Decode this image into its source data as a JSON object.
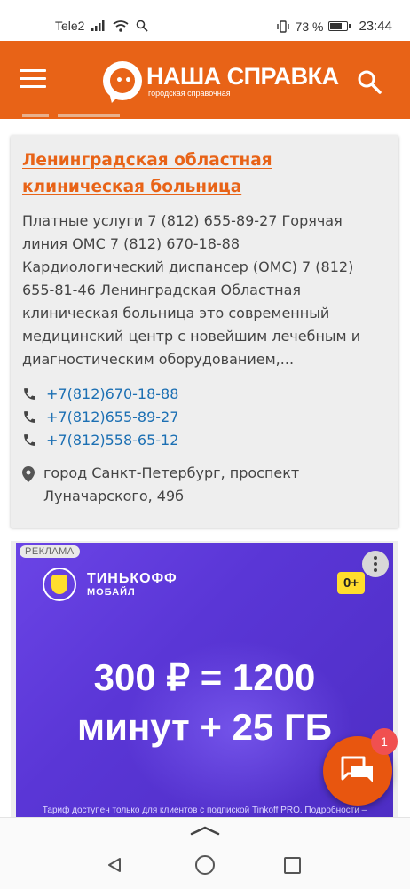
{
  "status_bar": {
    "carrier": "Tele2",
    "battery_percent": "73 %",
    "battery_level": 0.73,
    "time": "23:44"
  },
  "app_bar": {
    "logo_title": "НАША СПРАВКА",
    "logo_subtitle": "городская справочная",
    "menu_icon": "hamburger-menu-icon",
    "search_icon": "search-icon"
  },
  "listing": {
    "title": "Ленинградская областная клиническая больница",
    "description": "Платные услуги 7 (812) 655-89-27 Горячая линия ОМС 7 (812) 670-18-88 Кардиологический диспансер (ОМС) 7 (812) 655-81-46 Ленинградская Областная клиническая больница это современный медицинский центр с новейшим лечебным и диагностическим оборудованием,...",
    "phones": [
      "+7(812)670-18-88",
      "+7(812)655-89-27",
      "+7(812)558-65-12"
    ],
    "address": "город Санкт-Петербург, проспект Луначарского, 49б"
  },
  "ad": {
    "label": "РЕКЛАМА",
    "brand_line1": "ТИНЬКОФФ",
    "brand_line2": "МОБАЙЛ",
    "age_rating": "0+",
    "headline_line1": "300 ₽ = 1200",
    "headline_line2": "минут + 25 ГБ",
    "footnote": "Тариф доступен только для клиентов с подпиской Tinkoff PRO. Подробности –"
  },
  "chat": {
    "badge_count": "1"
  },
  "colors": {
    "brand_orange": "#e86317",
    "link_blue": "#1b6fb3",
    "ad_purple": "#5a36d6",
    "ad_yellow": "#ffdd2d"
  }
}
